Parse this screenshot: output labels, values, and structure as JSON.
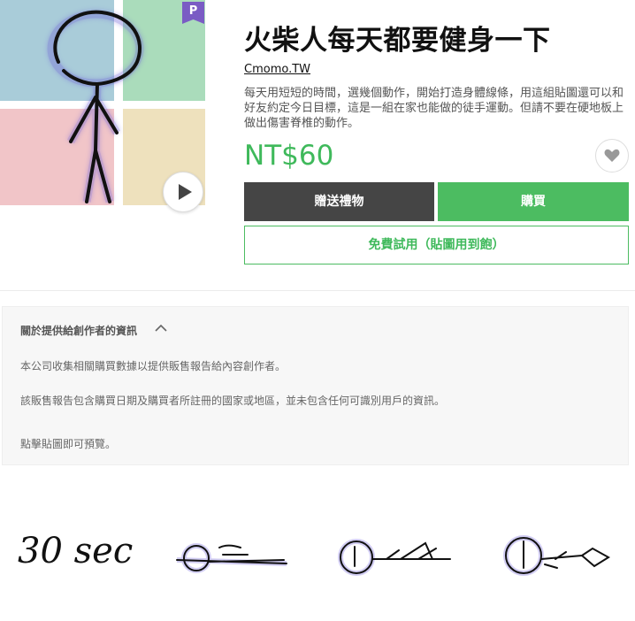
{
  "product": {
    "title": "火柴人每天都要健身一下",
    "author": "Cmomo.TW",
    "description": "每天用短短的時間，選幾個動作，開始打造身體線條，用這組貼圖還可以和好友約定今日目標，這是一組在家也能做的徒手運動。但請不要在硬地板上做出傷害脊椎的動作。",
    "price": "NT$60",
    "badge": "P"
  },
  "actions": {
    "gift_label": "贈送禮物",
    "buy_label": "購買",
    "trial_label": "免費試用（貼圖用到飽）"
  },
  "info": {
    "header": "關於提供給創作者的資訊",
    "line1": "本公司收集相關購買數據以提供販售報告給內容創作者。",
    "line2": "該販售報告包含購買日期及購買者所註冊的國家或地區，並未包含任何可識別用戶的資訊。",
    "line3": "點擊貼圖即可預覽。"
  },
  "preview": {
    "time_text": "30 sec"
  },
  "colors": {
    "accent_green": "#4cbc61",
    "price_green": "#3fb95b",
    "dark_button": "#454545",
    "premium_purple": "#7a5cc4",
    "stroke": "#111111",
    "glow": "#6b5bd6"
  },
  "icons": {
    "play": "play-icon",
    "favorite": "heart-icon",
    "collapse": "chevron-up-icon",
    "premium": "premium-badge-icon"
  }
}
